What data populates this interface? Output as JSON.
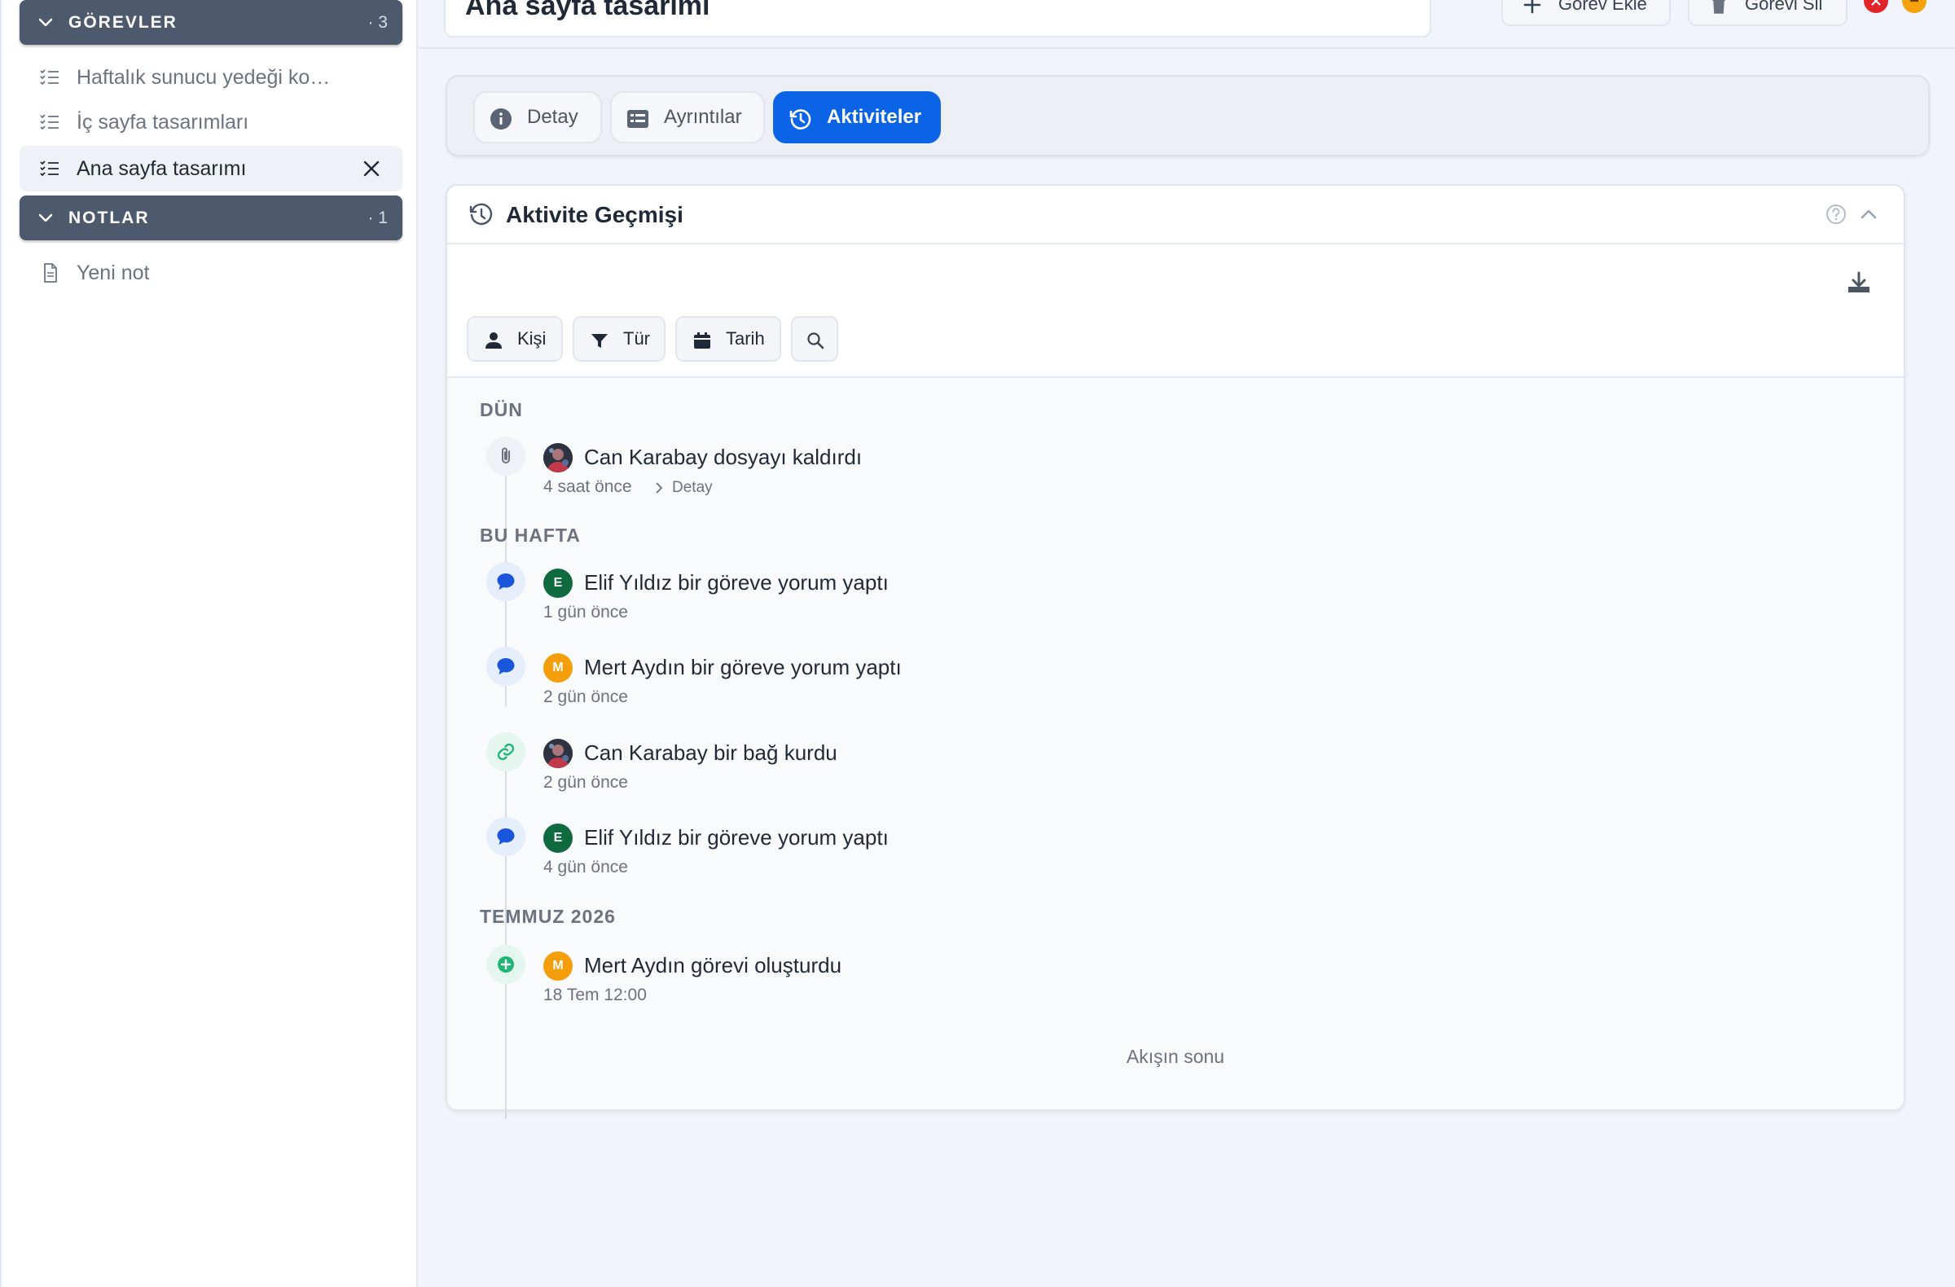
{
  "sidebar": {
    "tasks_header": {
      "title": "GÖREVLER",
      "count": "· 3"
    },
    "tasks": [
      {
        "label": "Haftalık sunucu yedeği ko…"
      },
      {
        "label": "İç sayfa tasarımları"
      },
      {
        "label": "Ana sayfa tasarımı",
        "active": true
      }
    ],
    "notes_header": {
      "title": "NOTLAR",
      "count": "· 1"
    },
    "notes": [
      {
        "label": "Yeni not"
      }
    ]
  },
  "topbar": {
    "title_value": "Ana sayfa tasarımı",
    "add_task_label": "Görev Ekle",
    "delete_task_label": "Görevi Sil"
  },
  "tabs": [
    {
      "label": "Detay",
      "icon": "info-icon"
    },
    {
      "label": "Ayrıntılar",
      "icon": "details-list-icon"
    },
    {
      "label": "Aktiviteler",
      "icon": "history-icon",
      "active": true
    }
  ],
  "panel": {
    "title": "Aktivite Geçmişi",
    "filters": [
      {
        "label": "Kişi",
        "icon": "person-icon"
      },
      {
        "label": "Tür",
        "icon": "filter-icon"
      },
      {
        "label": "Tarih",
        "icon": "calendar-icon"
      }
    ],
    "groups": [
      {
        "label": "DÜN",
        "events": [
          {
            "text": "Can Karabay dosyayı kaldırdı",
            "time": "4 saat önce",
            "detail": "Detay",
            "icon": "paperclip-icon"
          }
        ]
      },
      {
        "label": "BU HAFTA",
        "events": [
          {
            "text": "Elif Yıldız bir göreve yorum yaptı",
            "time": "1 gün önce",
            "icon": "comment-icon",
            "avatar": "E"
          },
          {
            "text": "Mert Aydın bir göreve yorum yaptı",
            "time": "2 gün önce",
            "icon": "comment-icon",
            "avatar": "M"
          },
          {
            "text": "Can Karabay bir bağ kurdu",
            "time": "2 gün önce",
            "icon": "link-icon"
          },
          {
            "text": "Elif Yıldız bir göreve yorum yaptı",
            "time": "4 gün önce",
            "icon": "comment-icon",
            "avatar": "E"
          }
        ]
      },
      {
        "label": "TEMMUZ 2026",
        "events": [
          {
            "text": "Mert Aydın görevi oluşturdu",
            "time": "18 Tem 12:00",
            "icon": "plus-circle-icon",
            "avatar": "M"
          }
        ]
      }
    ],
    "end_text": "Akışın sonu"
  },
  "colors": {
    "accent": "#0b63e5",
    "sidebar_header": "#4d5a6e",
    "avatar_elif": "#0f6b3f",
    "avatar_mert": "#f59e0b",
    "link_icon": "#22b573",
    "plus_icon": "#22b573",
    "comment_icon": "#1a56db"
  }
}
